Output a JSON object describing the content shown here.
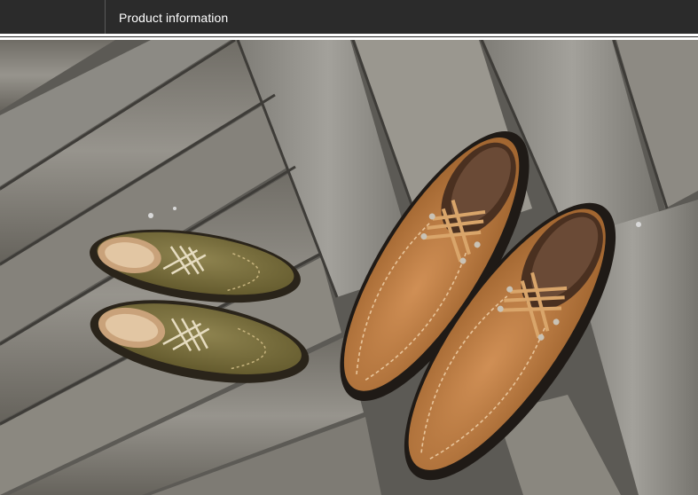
{
  "header": {
    "title": "Product information"
  },
  "photo": {
    "description_icon": "product-photo",
    "colors": {
      "header_bg": "#2b2b2b",
      "wood": "#8f8f8a",
      "shoe_tan": "#b8773c",
      "shoe_olive": "#7a6f3a"
    }
  }
}
